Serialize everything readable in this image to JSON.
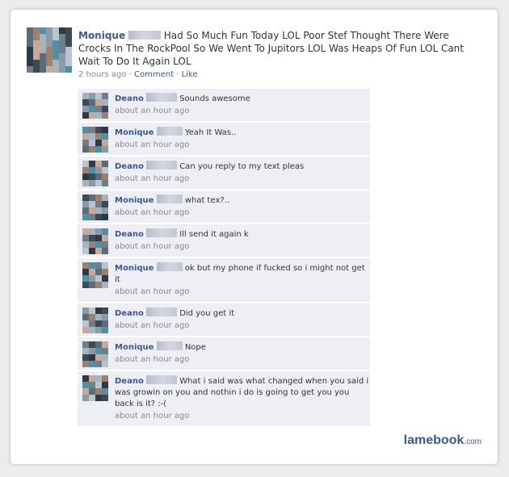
{
  "post": {
    "author": "Monique",
    "text": "Had So Much Fun Today LOL Poor Stef Thought There Were Crocks In The RockPool So We Went To Jupitors LOL Was Heaps Of Fun LOL Cant Wait To Do It Again LOL",
    "time": "2 hours ago",
    "comment_link": "Comment",
    "like_link": "Like",
    "separator": "·"
  },
  "comments": [
    {
      "author": "Deano",
      "text": "Sounds awesome",
      "time": "about an hour ago"
    },
    {
      "author": "Monique",
      "text": "Yeah It Was..",
      "time": "about an hour ago"
    },
    {
      "author": "Deano",
      "text": "Can you reply to my text pleas",
      "time": "about an hour ago"
    },
    {
      "author": "Monique",
      "text": "what tex?..",
      "time": "about an hour ago"
    },
    {
      "author": "Deano",
      "text": "Ill send it again k",
      "time": "about an hour ago"
    },
    {
      "author": "Monique",
      "text": "ok but my phone if fucked so i might not get it",
      "time": "about an hour ago"
    },
    {
      "author": "Deano",
      "text": "Did you get it",
      "time": "about an hour ago"
    },
    {
      "author": "Monique",
      "text": "Nope",
      "time": "about an hour ago"
    },
    {
      "author": "Deano",
      "text": "What i said was what changed when you said i was growin on you and nothin i do is going to get you you back is it? :-(",
      "time": "about an hour ago"
    }
  ],
  "watermark": {
    "brand": "lamebook",
    "tld": ".com"
  }
}
